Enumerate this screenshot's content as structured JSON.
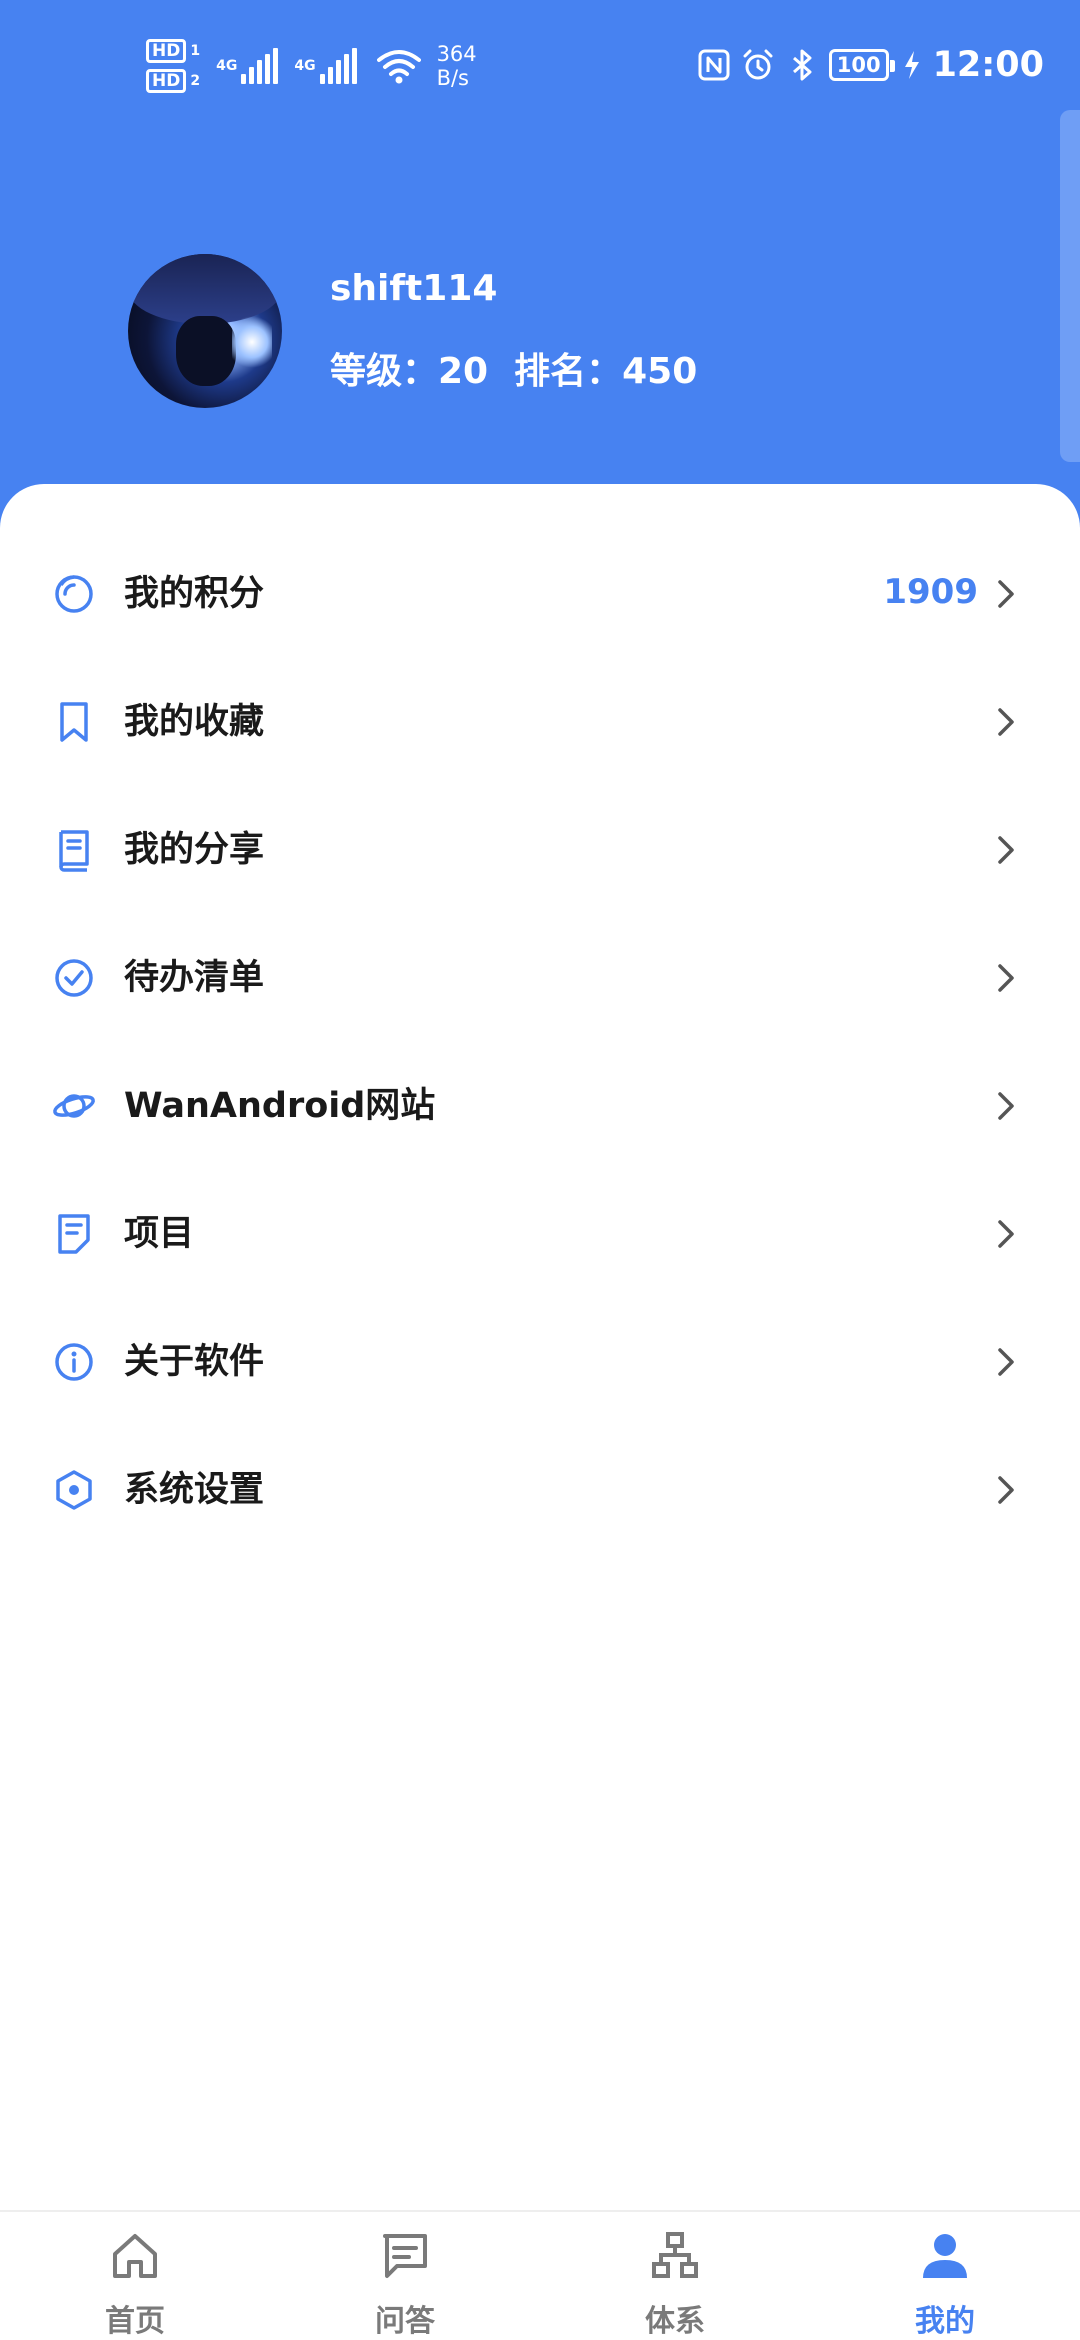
{
  "status_bar": {
    "sim1": "HD",
    "sim1_num": "1",
    "sim2": "HD",
    "sim2_num": "2",
    "net1": "4G",
    "net2": "4G",
    "speed_value": "364",
    "speed_unit": "B/s",
    "battery": "100",
    "time": "12:00"
  },
  "profile": {
    "username": "shift114",
    "level_text": "等级：20",
    "rank_text": "排名：450"
  },
  "menu": [
    {
      "label": "我的积分",
      "value": "1909",
      "icon": "points-icon"
    },
    {
      "label": "我的收藏",
      "value": "",
      "icon": "bookmark-icon"
    },
    {
      "label": "我的分享",
      "value": "",
      "icon": "book-icon"
    },
    {
      "label": "待办清单",
      "value": "",
      "icon": "check-circle-icon"
    },
    {
      "label": "WanAndroid网站",
      "value": "",
      "icon": "planet-icon"
    },
    {
      "label": "项目",
      "value": "",
      "icon": "document-icon"
    },
    {
      "label": "关于软件",
      "value": "",
      "icon": "info-icon"
    },
    {
      "label": "系统设置",
      "value": "",
      "icon": "settings-icon"
    }
  ],
  "bottom_nav": [
    {
      "label": "首页",
      "icon": "home-icon",
      "active": false
    },
    {
      "label": "问答",
      "icon": "chat-icon",
      "active": false
    },
    {
      "label": "体系",
      "icon": "hierarchy-icon",
      "active": false
    },
    {
      "label": "我的",
      "icon": "user-icon",
      "active": true
    }
  ],
  "colors": {
    "accent": "#4782F1",
    "nav_inactive": "#7a7a7a",
    "text": "#1a1a1a"
  }
}
